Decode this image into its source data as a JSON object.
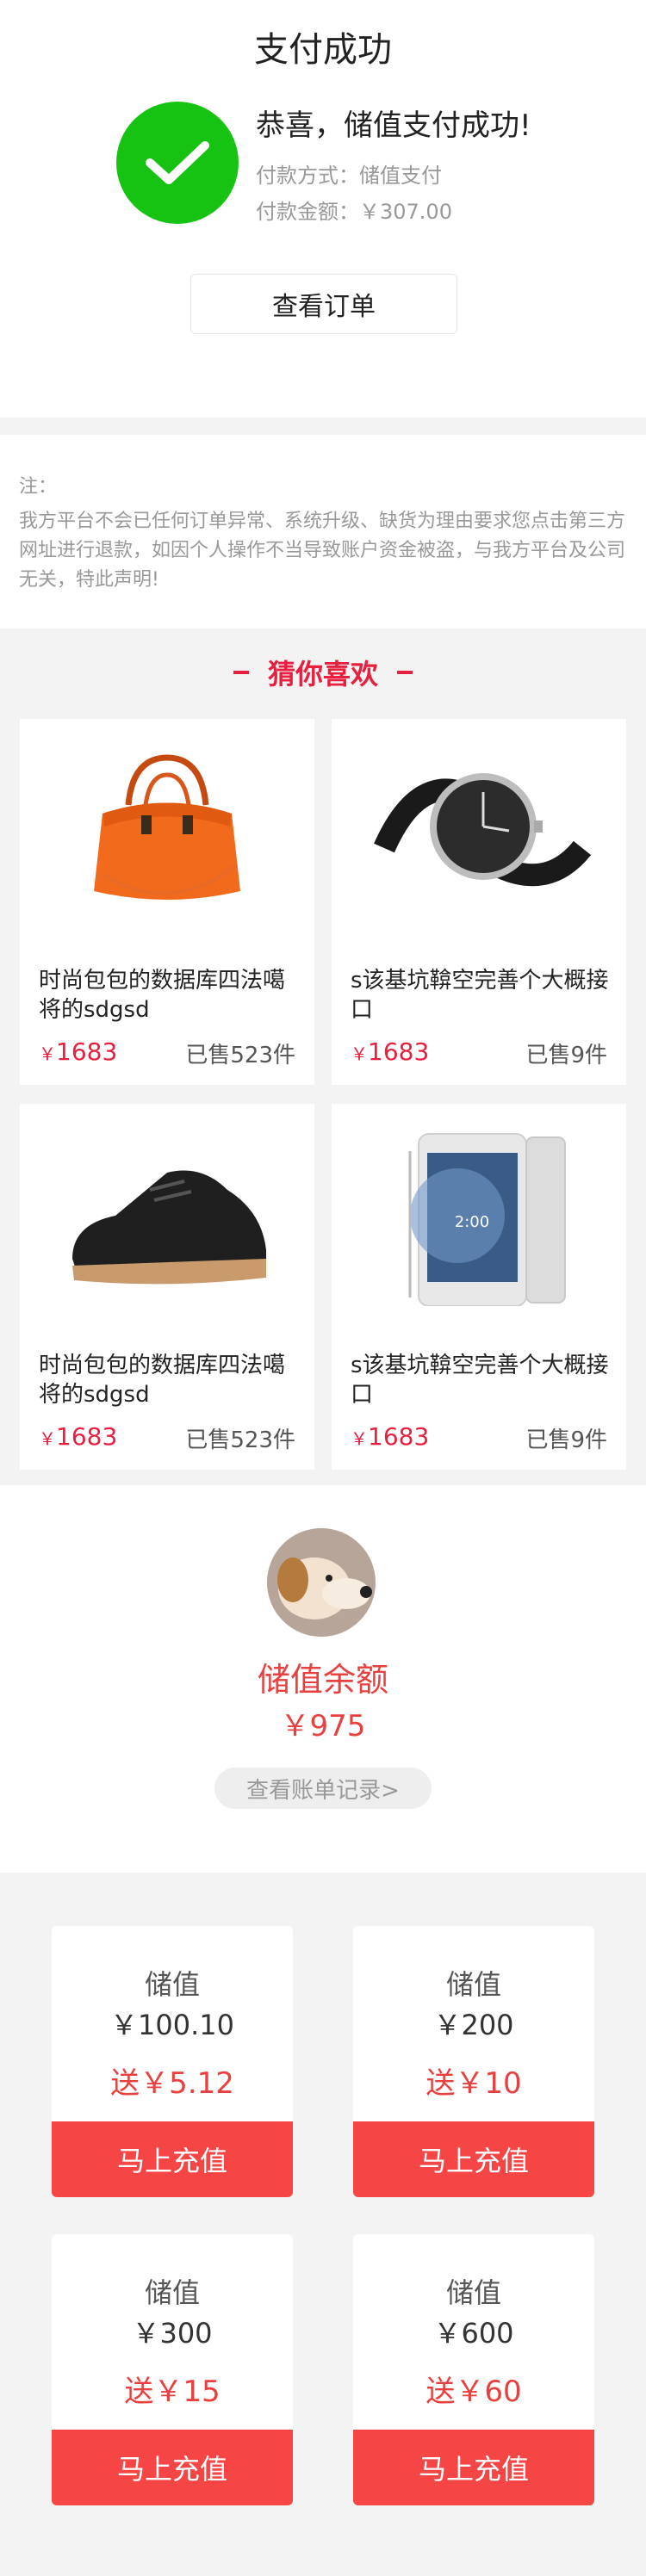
{
  "header": {
    "title": "支付成功"
  },
  "success": {
    "message": "恭喜，储值支付成功!",
    "method_label": "付款方式：",
    "method_value": "储值支付",
    "amount_label": "付款金额：",
    "amount_value": "￥307.00",
    "order_button": "查看订单"
  },
  "notice": {
    "title": "注：",
    "text": "我方平台不会已任何订单异常、系统升级、缺货为理由要求您点击第三方网址进行退款，如因个人操作不当导致账户资金被盗，与我方平台及公司无关，特此声明!"
  },
  "guess": {
    "heading": "猜你喜欢",
    "products": [
      {
        "name": "时尚包包的数据库四法噶将的sdgsd",
        "currency": "￥",
        "price": "1683",
        "sold": "已售523件",
        "icon": "handbag-image"
      },
      {
        "name": "s该基坑鞥空完善个大概接口",
        "currency": "￥",
        "price": "1683",
        "sold": "已售9件",
        "icon": "watch-image"
      },
      {
        "name": "时尚包包的数据库四法噶将的sdgsd",
        "currency": "￥",
        "price": "1683",
        "sold": "已售523件",
        "icon": "shoe-image"
      },
      {
        "name": "s该基坑鞥空完善个大概接口",
        "currency": "￥",
        "price": "1683",
        "sold": "已售9件",
        "icon": "phone-image"
      }
    ]
  },
  "balance": {
    "label": "储值余额",
    "value": "￥975",
    "history_button": "查看账单记录>"
  },
  "recharge": {
    "cards": [
      {
        "label": "储值",
        "amount": "￥100.10",
        "gift": "送￥5.12",
        "button": "马上充值"
      },
      {
        "label": "储值",
        "amount": "￥200",
        "gift": "送￥10",
        "button": "马上充值"
      },
      {
        "label": "储值",
        "amount": "￥300",
        "gift": "送￥15",
        "button": "马上充值"
      },
      {
        "label": "储值",
        "amount": "￥600",
        "gift": "送￥60",
        "button": "马上充值"
      }
    ]
  },
  "colors": {
    "success_green": "#16c312",
    "accent_red": "#e8203f",
    "button_red": "#f54545"
  }
}
